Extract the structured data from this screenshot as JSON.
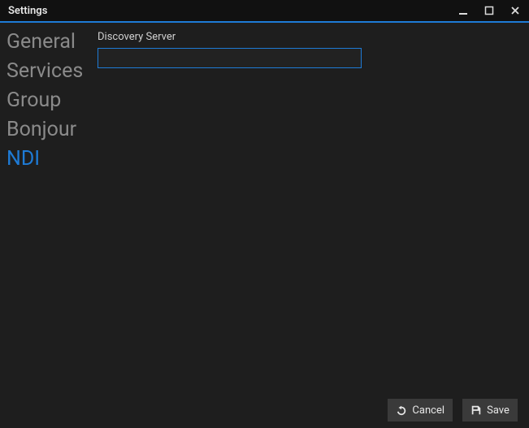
{
  "window": {
    "title": "Settings"
  },
  "sidebar": {
    "items": [
      {
        "label": "General"
      },
      {
        "label": "Services"
      },
      {
        "label": "Group"
      },
      {
        "label": "Bonjour"
      },
      {
        "label": "NDI"
      }
    ],
    "active_index": 4
  },
  "content": {
    "discovery_server": {
      "label": "Discovery Server",
      "value": ""
    }
  },
  "footer": {
    "cancel_label": "Cancel",
    "save_label": "Save"
  },
  "colors": {
    "accent": "#1e7bd6",
    "bg": "#1e1e1e",
    "titlebar": "#111111",
    "button": "#3a3a3a"
  }
}
